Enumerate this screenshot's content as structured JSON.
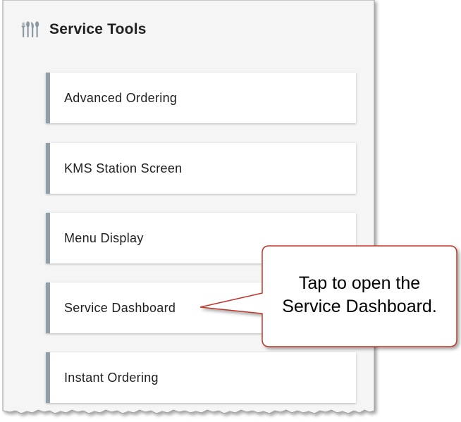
{
  "header": {
    "icon": "utensils-icon",
    "title": "Service Tools"
  },
  "tools": [
    {
      "label": "Advanced Ordering"
    },
    {
      "label": "KMS Station Screen"
    },
    {
      "label": "Menu Display"
    },
    {
      "label": "Service Dashboard"
    },
    {
      "label": "Instant Ordering"
    }
  ],
  "callout": {
    "line1": "Tap to open the",
    "line2": "Service Dashboard.",
    "border_color": "#c0392b"
  },
  "colors": {
    "panel_bg": "#f5f5f5",
    "card_accent": "#8fa0aa"
  }
}
